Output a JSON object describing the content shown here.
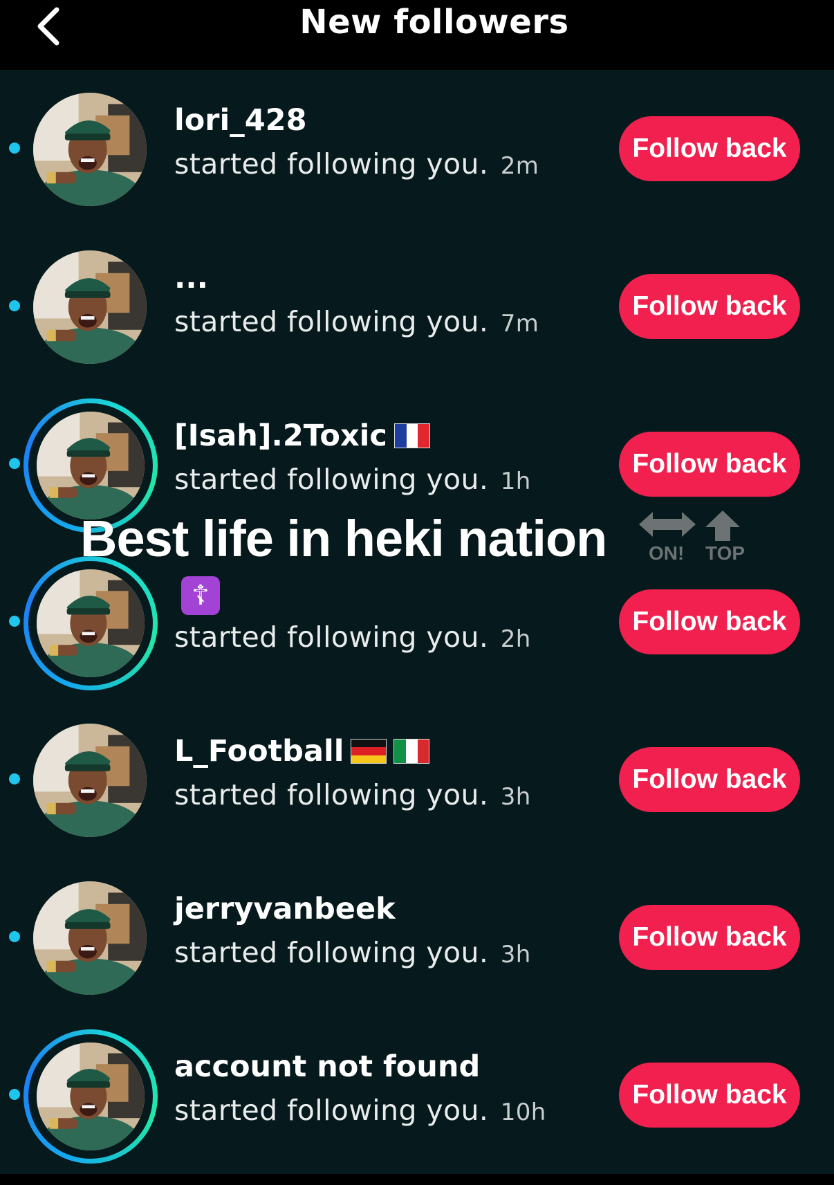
{
  "header": {
    "title": "New followers"
  },
  "followers": [
    {
      "username": "lori_428",
      "activity": "started following you.",
      "time": "2m",
      "button": "Follow back",
      "ring": false,
      "badges": []
    },
    {
      "username": "...",
      "activity": "started following you.",
      "time": "7m",
      "button": "Follow back",
      "ring": false,
      "badges": []
    },
    {
      "username": "[Isah].2Toxic",
      "activity": "started following you.",
      "time": "1h",
      "button": "Follow back",
      "ring": true,
      "badges": [
        "flag-france"
      ]
    },
    {
      "username": "",
      "activity": "started following you.",
      "time": "2h",
      "button": "Follow back",
      "ring": true,
      "badges": [
        "orthodox-cross-emoji"
      ]
    },
    {
      "username": "L_Football",
      "activity": "started following you.",
      "time": "3h",
      "button": "Follow back",
      "ring": false,
      "badges": [
        "flag-germany",
        "flag-italy"
      ]
    },
    {
      "username": "jerryvanbeek",
      "activity": "started following you.",
      "time": "3h",
      "button": "Follow back",
      "ring": false,
      "badges": []
    },
    {
      "username": "account not found",
      "activity": "started following you.",
      "time": "10h",
      "button": "Follow back",
      "ring": true,
      "badges": []
    }
  ],
  "overlay": {
    "caption": "Best life in heki nation",
    "label_on": "ON!",
    "label_top": "TOP"
  },
  "colors": {
    "background": "#06191c",
    "header": "#000000",
    "button": "#f2204e",
    "unread_dot": "#1ec6ee"
  },
  "icons": [
    "back-chevron-icon",
    "unread-dot-icon",
    "double-arrow-icon",
    "up-arrow-icon"
  ]
}
